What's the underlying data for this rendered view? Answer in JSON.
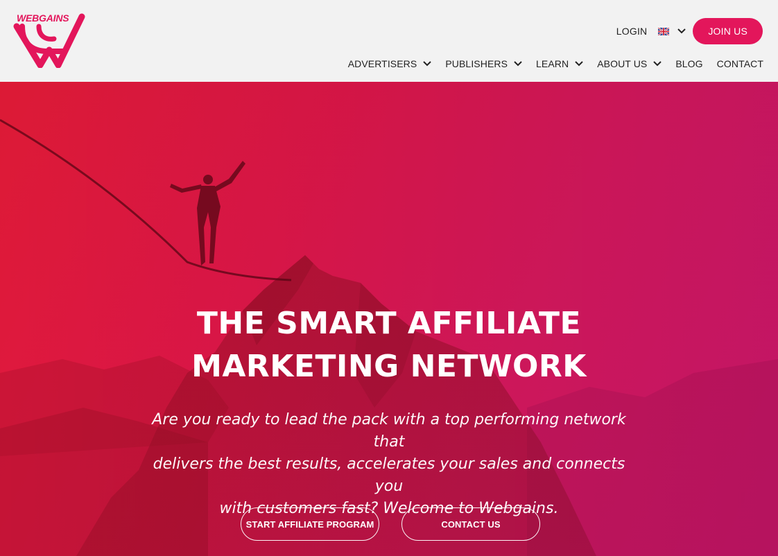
{
  "brand": {
    "name": "WEBGAINS",
    "accent_color": "#e3165b"
  },
  "header": {
    "login_label": "LOGIN",
    "language_icon": "uk-flag-icon",
    "join_label": "JOIN US",
    "nav": [
      {
        "label": "ADVERTISERS",
        "has_dropdown": true
      },
      {
        "label": "PUBLISHERS",
        "has_dropdown": true
      },
      {
        "label": "LEARN",
        "has_dropdown": true
      },
      {
        "label": "ABOUT US",
        "has_dropdown": true
      },
      {
        "label": "BLOG",
        "has_dropdown": false
      },
      {
        "label": "CONTACT",
        "has_dropdown": false
      }
    ]
  },
  "hero": {
    "title_line1": "THE SMART AFFILIATE",
    "title_line2": "MARKETING NETWORK",
    "subtitle_line1": "Are you ready to lead the pack with a top performing network that",
    "subtitle_line2": "delivers the best results, accelerates your sales and connects you",
    "subtitle_line3": "with customers fast? Welcome to Webgains.",
    "primary_cta": "START AFFILIATE PROGRAM",
    "secondary_cta": "CONTACT US",
    "overlay_colors": [
      "#dc1a35",
      "#e21a78"
    ]
  }
}
